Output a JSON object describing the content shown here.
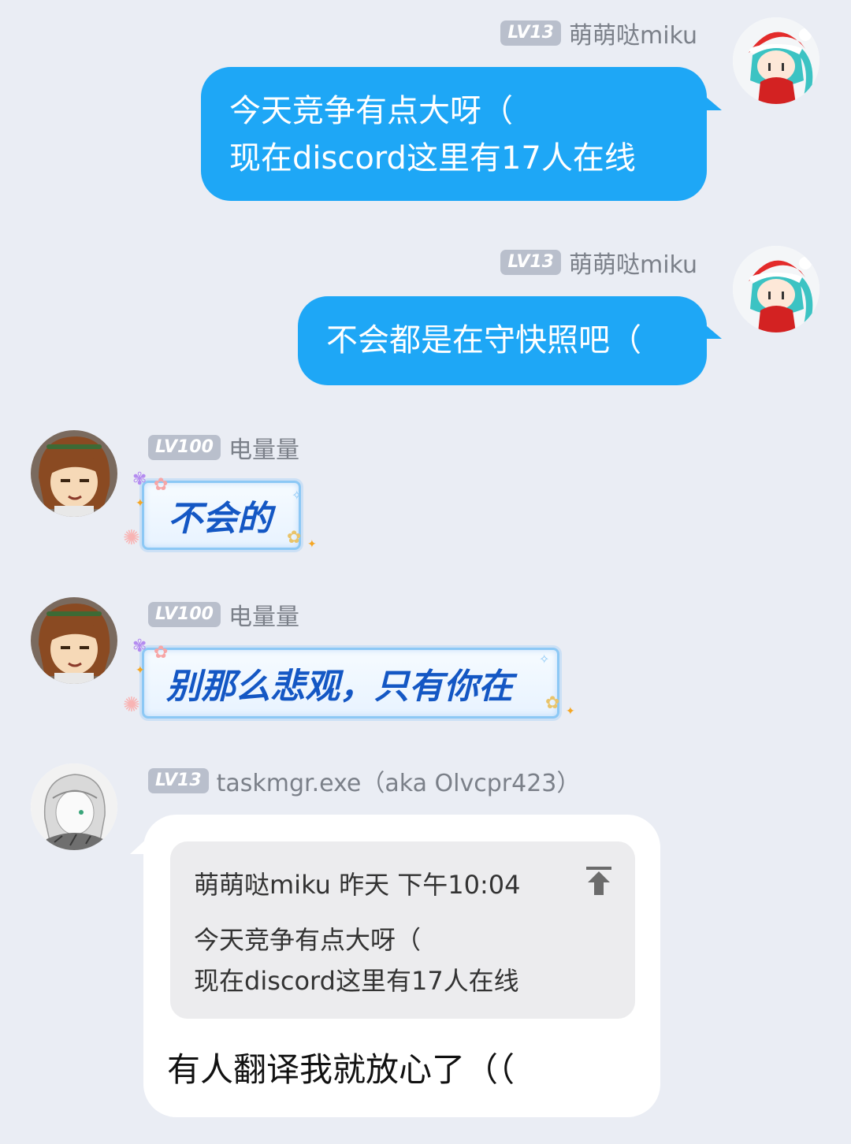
{
  "messages": {
    "m1": {
      "level": "LV13",
      "name": "萌萌哒miku",
      "lines": [
        "今天竞争有点大呀（",
        "现在discord这里有17人在线"
      ]
    },
    "m2": {
      "level": "LV13",
      "name": "萌萌哒miku",
      "lines": [
        "不会都是在守快照吧（"
      ]
    },
    "m3": {
      "level": "LV100",
      "name": "电量量",
      "text": "不会的"
    },
    "m4": {
      "level": "LV100",
      "name": "电量量",
      "text": "别那么悲观，只有你在"
    },
    "m5": {
      "level": "LV13",
      "name": "taskmgr.exe（aka Olvcpr423）",
      "quote": {
        "header": "萌萌哒miku 昨天 下午10:04",
        "lines": [
          "今天竞争有点大呀（",
          "现在discord这里有17人在线"
        ]
      },
      "reply": "有人翻译我就放心了（（"
    }
  },
  "colors": {
    "background": "#eaedf4",
    "bubble_blue": "#1ea7f6",
    "fancy_text": "#1457c4"
  },
  "icons": {
    "jump_to_quote": "arrow-up-to-line-icon"
  }
}
